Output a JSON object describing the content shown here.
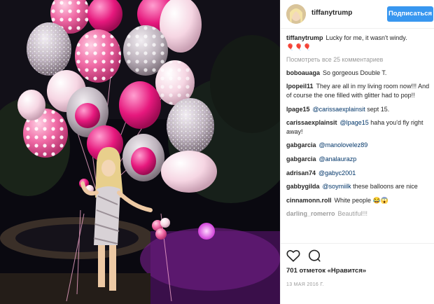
{
  "header": {
    "username": "tiffanytrump",
    "follow_label": "Подписаться"
  },
  "caption": {
    "username": "tiffanytrump",
    "text": "Lucky for me, it wasn't windy.",
    "emoji": "🎈🎈🎈"
  },
  "view_all_label": "Посмотреть все 25 комментариев",
  "comments": [
    {
      "user": "boboauaga",
      "text": "So gorgeous Double T."
    },
    {
      "user": "lpopeil11",
      "text": "They are all in my living room now!!! And of course the one filled with glitter had to pop!!"
    },
    {
      "user": "lpage15",
      "mention": "@carissaexplainsit",
      "text": "sept 15."
    },
    {
      "user": "carissaexplainsit",
      "mention": "@lpage15",
      "text": "haha you'd fly right away!"
    },
    {
      "user": "gabgarcia",
      "mention": "@manolovelez89",
      "text": ""
    },
    {
      "user": "gabgarcia",
      "mention": "@analaurazp",
      "text": ""
    },
    {
      "user": "adrisan74",
      "mention": "@gabyc2001",
      "text": ""
    },
    {
      "user": "gabbygilda",
      "mention": "@soymiilk",
      "text": "these balloons are nice"
    },
    {
      "user": "cinnamonn.roll",
      "text": "White people 😂😱"
    },
    {
      "user": "darling_romerro",
      "text": "Beautiful!!!"
    }
  ],
  "icons": {
    "like": "heart-icon",
    "comment": "comment-bubble-icon"
  },
  "likes_text": "701 отметок «Нравится»",
  "date_text": "13 МАЯ 2016 Г."
}
